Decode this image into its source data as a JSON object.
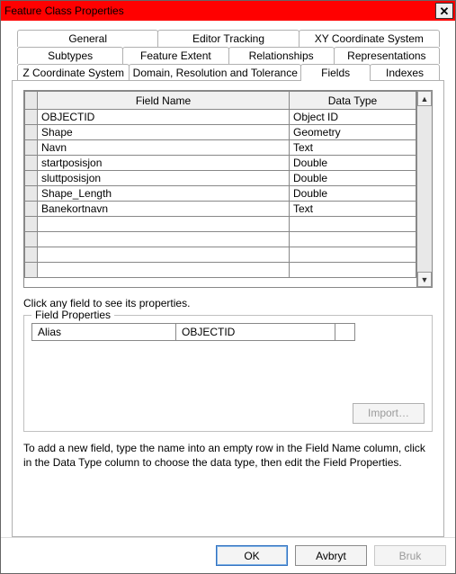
{
  "window": {
    "title": "Feature Class Properties",
    "close_glyph": "✕"
  },
  "tabs": {
    "row1": [
      "General",
      "Editor Tracking",
      "XY Coordinate System"
    ],
    "row2": [
      "Subtypes",
      "Feature Extent",
      "Relationships",
      "Representations"
    ],
    "row3": [
      "Z Coordinate System",
      "Domain, Resolution and Tolerance",
      "Fields",
      "Indexes"
    ],
    "active": "Fields"
  },
  "grid": {
    "headers": {
      "name": "Field Name",
      "type": "Data Type"
    },
    "rows": [
      {
        "name": "OBJECTID",
        "type": "Object ID"
      },
      {
        "name": "Shape",
        "type": "Geometry"
      },
      {
        "name": "Navn",
        "type": "Text"
      },
      {
        "name": "startposisjon",
        "type": "Double"
      },
      {
        "name": "sluttposisjon",
        "type": "Double"
      },
      {
        "name": "Shape_Length",
        "type": "Double"
      },
      {
        "name": "Banekortnavn",
        "type": "Text"
      },
      {
        "name": "",
        "type": ""
      },
      {
        "name": "",
        "type": ""
      },
      {
        "name": "",
        "type": ""
      },
      {
        "name": "",
        "type": ""
      }
    ],
    "scroll": {
      "up": "▲",
      "down": "▼"
    }
  },
  "hint": "Click any field to see its properties.",
  "field_props": {
    "legend": "Field Properties",
    "alias_label": "Alias",
    "alias_value": "OBJECTID",
    "import_label": "Import…"
  },
  "help": "To add a new field, type the name into an empty row in the Field Name column, click in the Data Type column to choose the data type, then edit the Field Properties.",
  "footer": {
    "ok": "OK",
    "cancel": "Avbryt",
    "apply": "Bruk"
  }
}
